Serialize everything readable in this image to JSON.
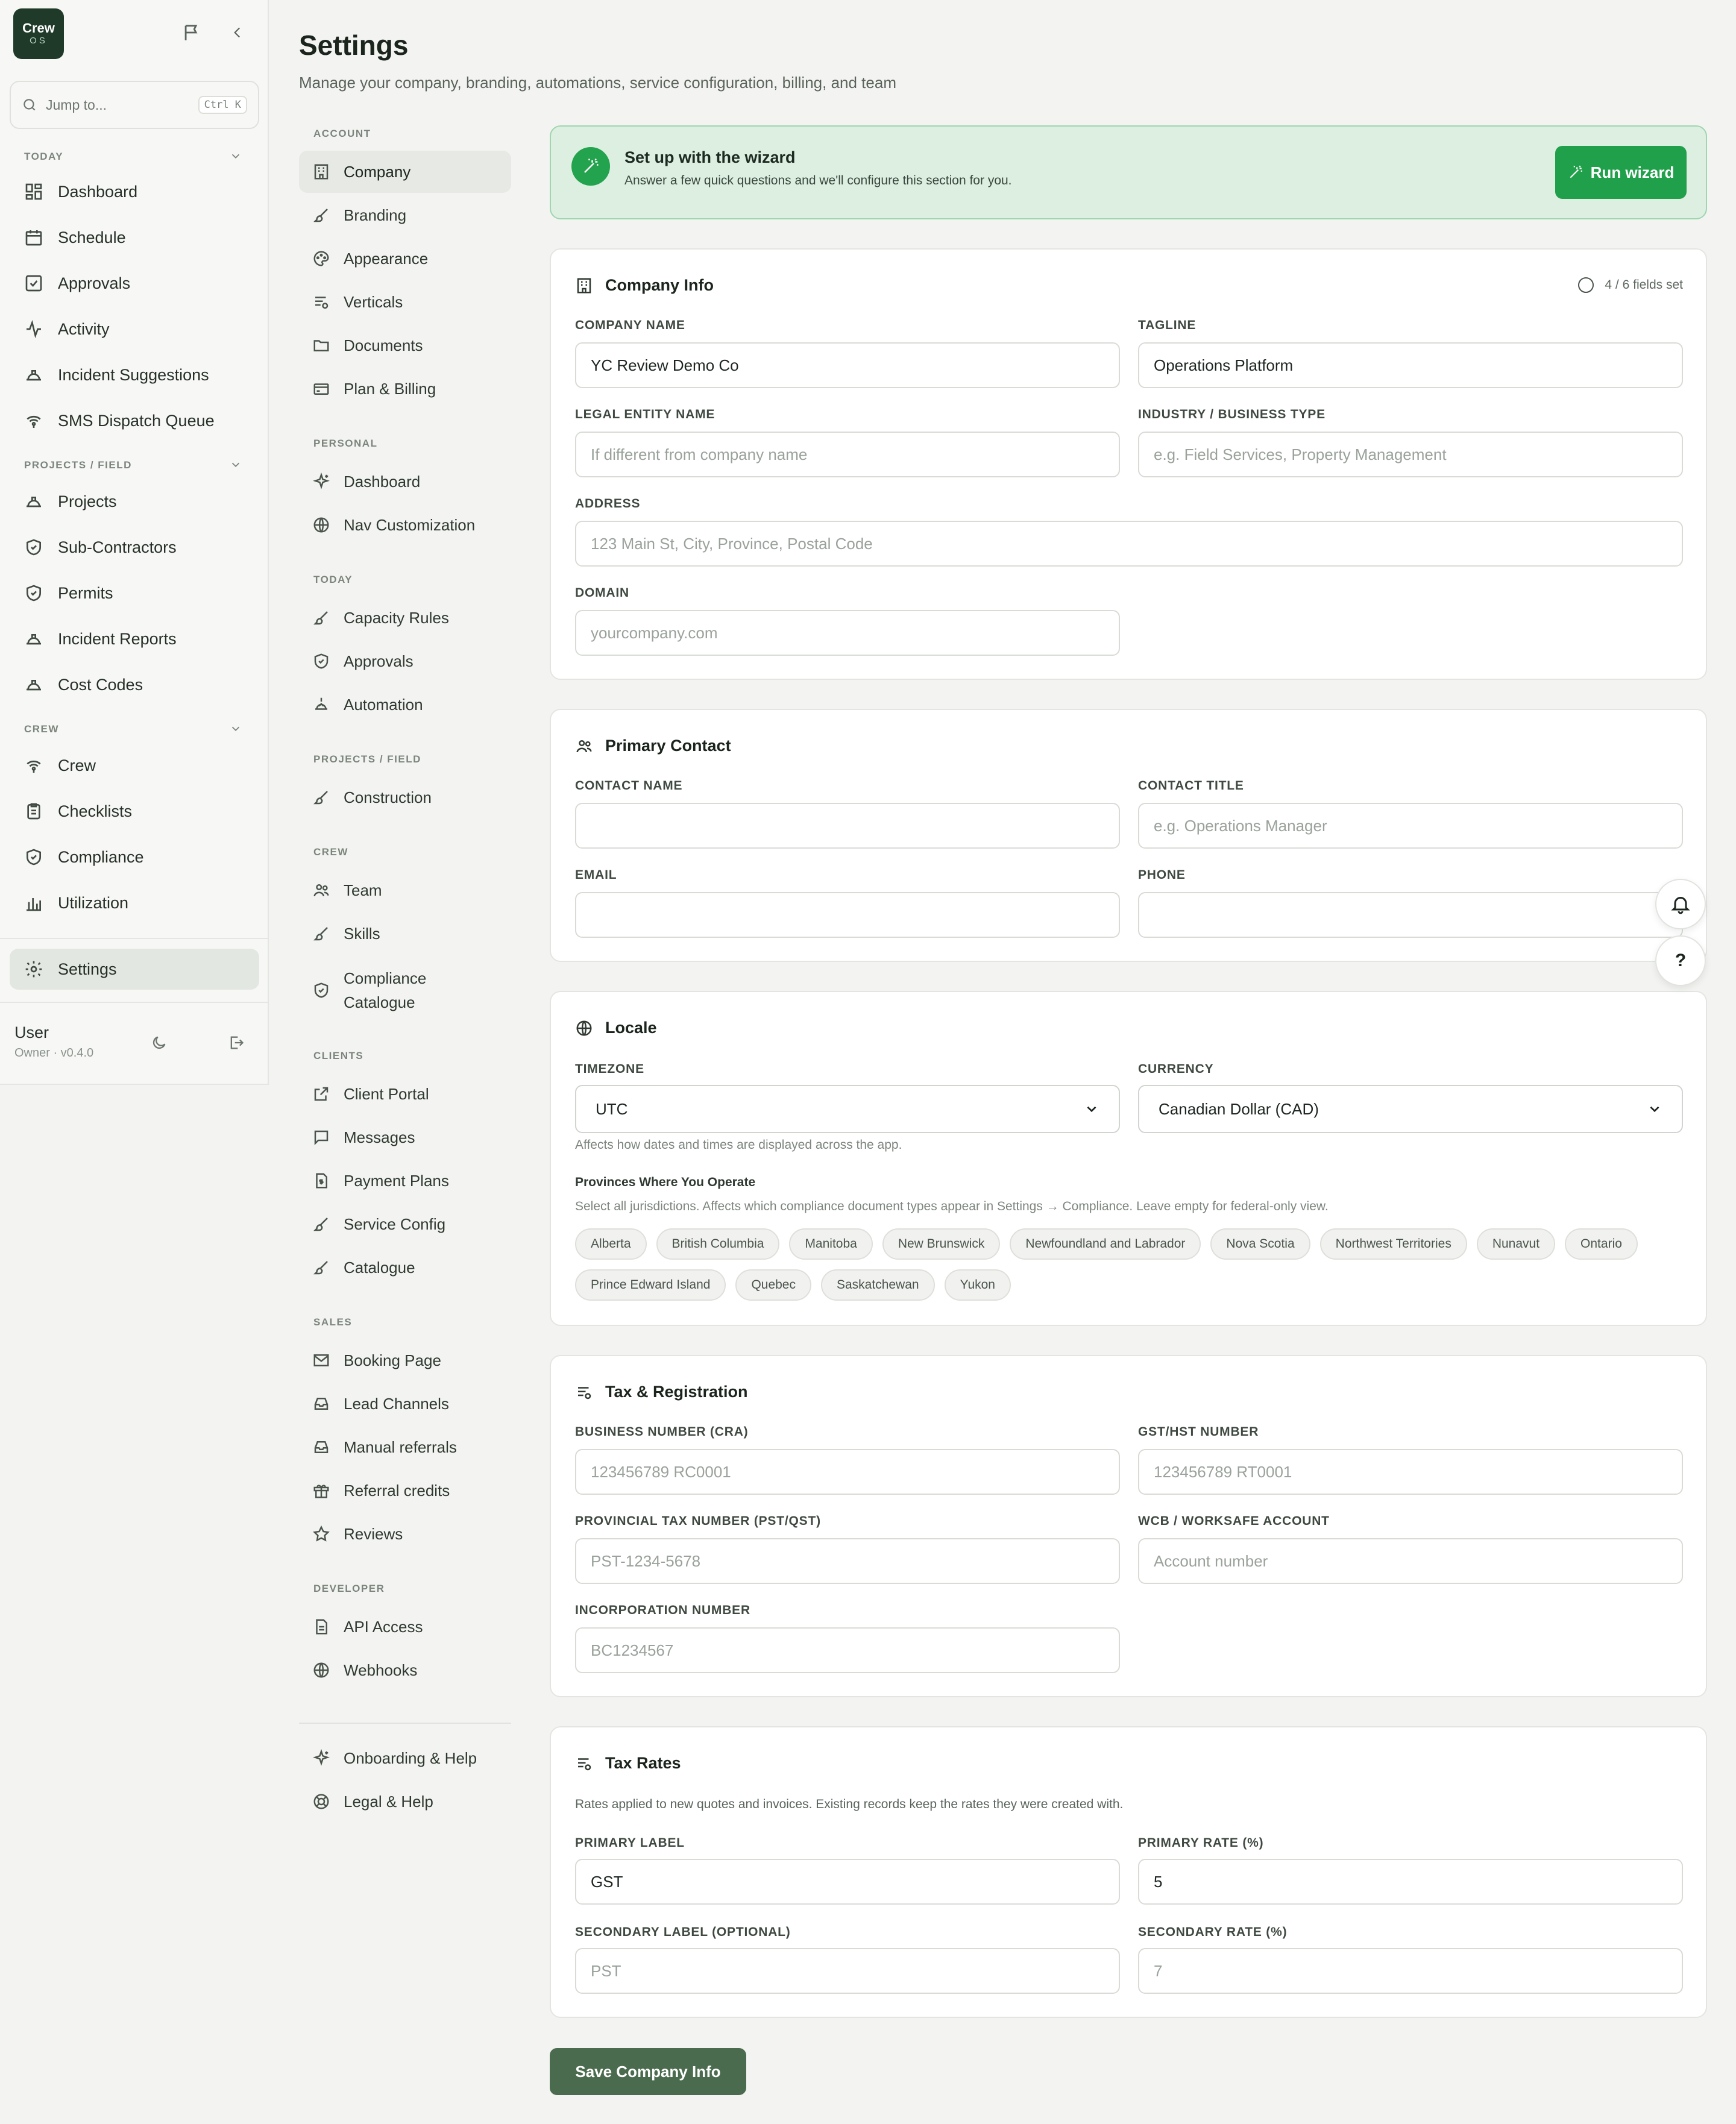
{
  "app": {
    "logo_top": "Crew",
    "logo_bottom": "OS",
    "jump_placeholder": "Jump to...",
    "jump_shortcut": "Ctrl K",
    "sections": [
      {
        "label": "TODAY",
        "items": [
          "Dashboard",
          "Schedule",
          "Approvals",
          "Activity",
          "Incident Suggestions",
          "SMS Dispatch Queue"
        ]
      },
      {
        "label": "PROJECTS / FIELD",
        "items": [
          "Projects",
          "Sub-Contractors",
          "Permits",
          "Incident Reports",
          "Cost Codes"
        ]
      },
      {
        "label": "CREW",
        "items": [
          "Crew",
          "Checklists",
          "Compliance",
          "Utilization"
        ]
      }
    ],
    "settings_label": "Settings",
    "user_name": "User",
    "user_role": "Owner · v0.4.0"
  },
  "page": {
    "title": "Settings",
    "subtitle": "Manage your company, branding, automations, service configuration, billing, and team"
  },
  "settings_nav": {
    "account_label": "ACCOUNT",
    "account": [
      "Company",
      "Branding",
      "Appearance",
      "Verticals",
      "Documents",
      "Plan & Billing"
    ],
    "personal_label": "PERSONAL",
    "personal": [
      "Dashboard",
      "Nav Customization"
    ],
    "today_label": "TODAY",
    "today": [
      "Capacity Rules",
      "Approvals",
      "Automation"
    ],
    "projects_label": "PROJECTS / FIELD",
    "projects": [
      "Construction"
    ],
    "crew_label": "CREW",
    "crew": [
      "Team",
      "Skills"
    ],
    "crew_compliance_1": "Compliance",
    "crew_compliance_2": "Catalogue",
    "clients_label": "CLIENTS",
    "clients": [
      "Client Portal",
      "Messages",
      "Payment Plans",
      "Service Config",
      "Catalogue"
    ],
    "sales_label": "SALES",
    "sales": [
      "Booking Page",
      "Lead Channels",
      "Manual referrals",
      "Referral credits",
      "Reviews"
    ],
    "developer_label": "DEVELOPER",
    "developer": [
      "API Access",
      "Webhooks"
    ],
    "footer": [
      "Onboarding & Help",
      "Legal & Help"
    ]
  },
  "wizard": {
    "title": "Set up with the wizard",
    "subtitle": "Answer a few quick questions and we'll configure this section for you.",
    "button": "Run wizard"
  },
  "company_info": {
    "title": "Company Info",
    "fields_set": "4 / 6 fields set",
    "company_name_label": "COMPANY NAME",
    "company_name_value": "YC Review Demo Co",
    "tagline_label": "TAGLINE",
    "tagline_value": "Operations Platform",
    "legal_label": "LEGAL ENTITY NAME",
    "legal_placeholder": "If different from company name",
    "industry_label": "INDUSTRY / BUSINESS TYPE",
    "industry_placeholder": "e.g. Field Services, Property Management",
    "address_label": "ADDRESS",
    "address_placeholder": "123 Main St, City, Province, Postal Code",
    "domain_label": "DOMAIN",
    "domain_placeholder": "yourcompany.com"
  },
  "primary_contact": {
    "title": "Primary Contact",
    "name_label": "CONTACT NAME",
    "title_label": "CONTACT TITLE",
    "title_placeholder": "e.g. Operations Manager",
    "email_label": "EMAIL",
    "phone_label": "PHONE"
  },
  "locale": {
    "title": "Locale",
    "timezone_label": "TIMEZONE",
    "timezone_value": "UTC",
    "currency_label": "CURRENCY",
    "currency_value": "Canadian Dollar (CAD)",
    "timezone_hint": "Affects how dates and times are displayed across the app.",
    "provinces_title": "Provinces Where You Operate",
    "provinces_hint": "Select all jurisdictions. Affects which compliance document types appear in Settings → Compliance. Leave empty for federal-only view.",
    "provinces": [
      "Alberta",
      "British Columbia",
      "Manitoba",
      "New Brunswick",
      "Newfoundland and Labrador",
      "Nova Scotia",
      "Northwest Territories",
      "Nunavut",
      "Ontario",
      "Prince Edward Island",
      "Quebec",
      "Saskatchewan",
      "Yukon"
    ]
  },
  "tax_registration": {
    "title": "Tax & Registration",
    "bn_label": "BUSINESS NUMBER (CRA)",
    "bn_placeholder": "123456789 RC0001",
    "gst_label": "GST/HST NUMBER",
    "gst_placeholder": "123456789 RT0001",
    "pst_label": "PROVINCIAL TAX NUMBER (PST/QST)",
    "pst_placeholder": "PST-1234-5678",
    "wcb_label": "WCB / WORKSAFE ACCOUNT",
    "wcb_placeholder": "Account number",
    "inc_label": "INCORPORATION NUMBER",
    "inc_placeholder": "BC1234567"
  },
  "tax_rates": {
    "title": "Tax Rates",
    "description": "Rates applied to new quotes and invoices. Existing records keep the rates they were created with.",
    "primary_label_label": "PRIMARY LABEL",
    "primary_label_value": "GST",
    "primary_rate_label": "PRIMARY RATE (%)",
    "primary_rate_value": "5",
    "secondary_label_label": "SECONDARY LABEL (OPTIONAL)",
    "secondary_label_placeholder": "PST",
    "secondary_rate_label": "SECONDARY RATE (%)",
    "secondary_rate_placeholder": "7"
  },
  "save_button": "Save Company Info",
  "float_help": "?",
  "colors": {
    "accent_green": "#20a04a",
    "save_green": "#4a6b4d",
    "wizard_bg": "#dcefe1"
  }
}
